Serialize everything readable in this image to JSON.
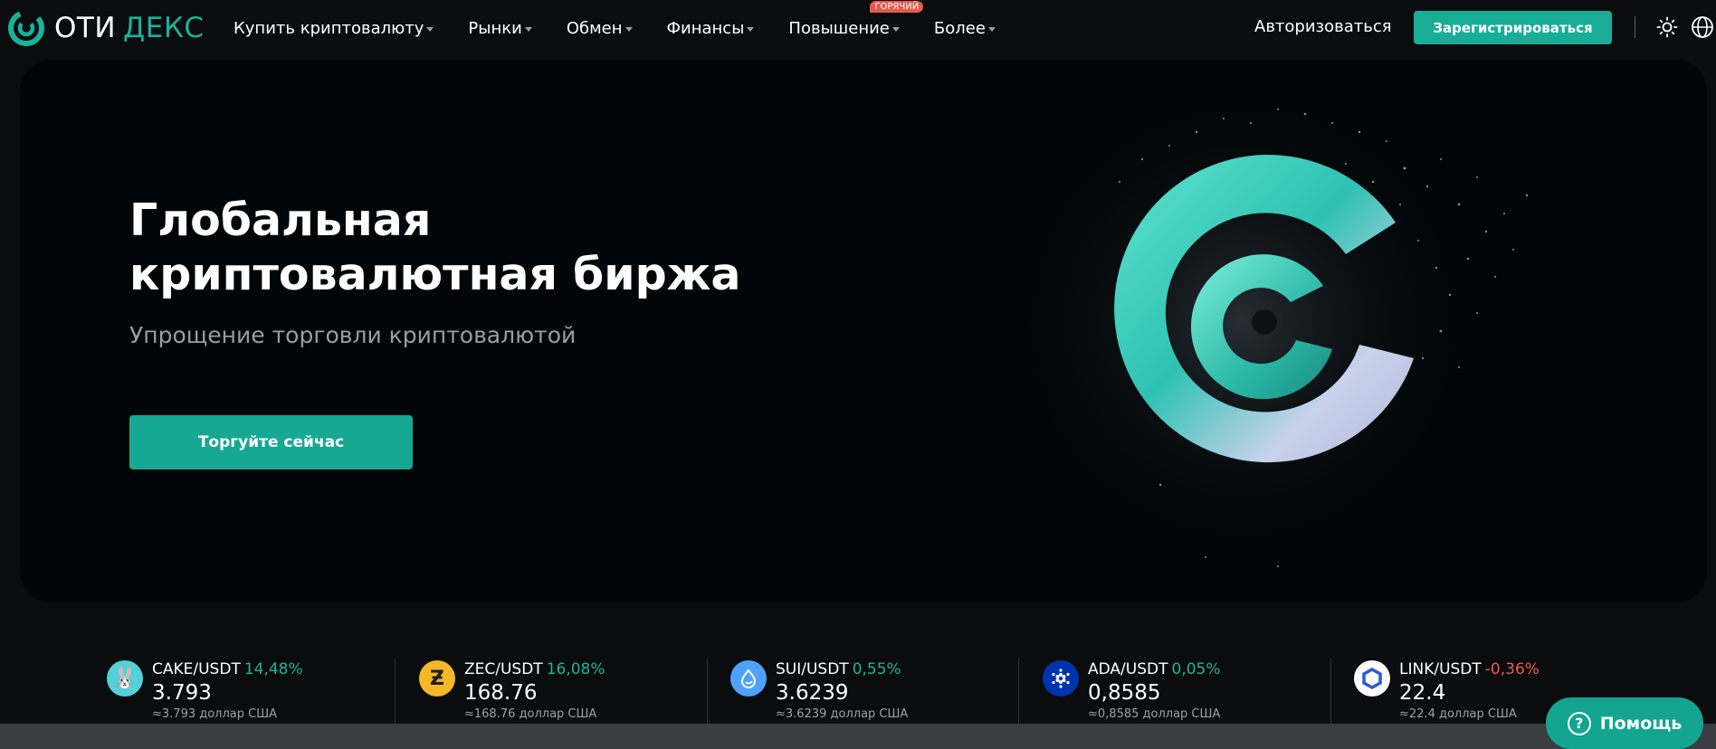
{
  "brand": {
    "name_white": "ОТИ",
    "name_green": "ДЕКС",
    "accent_color": "#19b39a"
  },
  "nav": {
    "items": [
      {
        "label": "Купить криптовалюту"
      },
      {
        "label": "Рынки"
      },
      {
        "label": "Обмен"
      },
      {
        "label": "Финансы"
      },
      {
        "label": "Повышение",
        "badge": "ГОРЯЧИЙ"
      },
      {
        "label": "Более"
      }
    ],
    "login_label": "Авторизоваться",
    "register_label": "Зарегистрироваться",
    "icons": [
      "theme-sun-icon",
      "globe-icon"
    ]
  },
  "hero": {
    "title": "Глобальная криптовалютная биржа",
    "subtitle": "Упрощение торговли криптовалютой",
    "cta_label": "Торгуйте сейчас"
  },
  "ticker": {
    "items": [
      {
        "pair": "CAKE/USDT",
        "change": "14,48%",
        "direction": "up",
        "price": "3.793",
        "approx": "≈3.793 доллар США",
        "icon": "cake-coin-icon",
        "icon_color": "#53d1d6"
      },
      {
        "pair": "ZEC/USDT",
        "change": "16,08%",
        "direction": "up",
        "price": "168.76",
        "approx": "≈168.76 доллар США",
        "icon": "zec-coin-icon",
        "icon_color": "#f4b728"
      },
      {
        "pair": "SUI/USDT",
        "change": "0,55%",
        "direction": "up",
        "price": "3.6239",
        "approx": "≈3.6239 доллар США",
        "icon": "sui-coin-icon",
        "icon_color": "#4da2ff"
      },
      {
        "pair": "ADA/USDT",
        "change": "0,05%",
        "direction": "up",
        "price": "0,8585",
        "approx": "≈0,8585 доллар США",
        "icon": "ada-coin-icon",
        "icon_color": "#0033ad"
      },
      {
        "pair": "LINK/USDT",
        "change": "-0,36%",
        "direction": "down",
        "price": "22.4",
        "approx": "≈22.4 доллар США",
        "icon": "link-coin-icon",
        "icon_color": "#ffffff"
      }
    ]
  },
  "help": {
    "label": "Помощь"
  }
}
